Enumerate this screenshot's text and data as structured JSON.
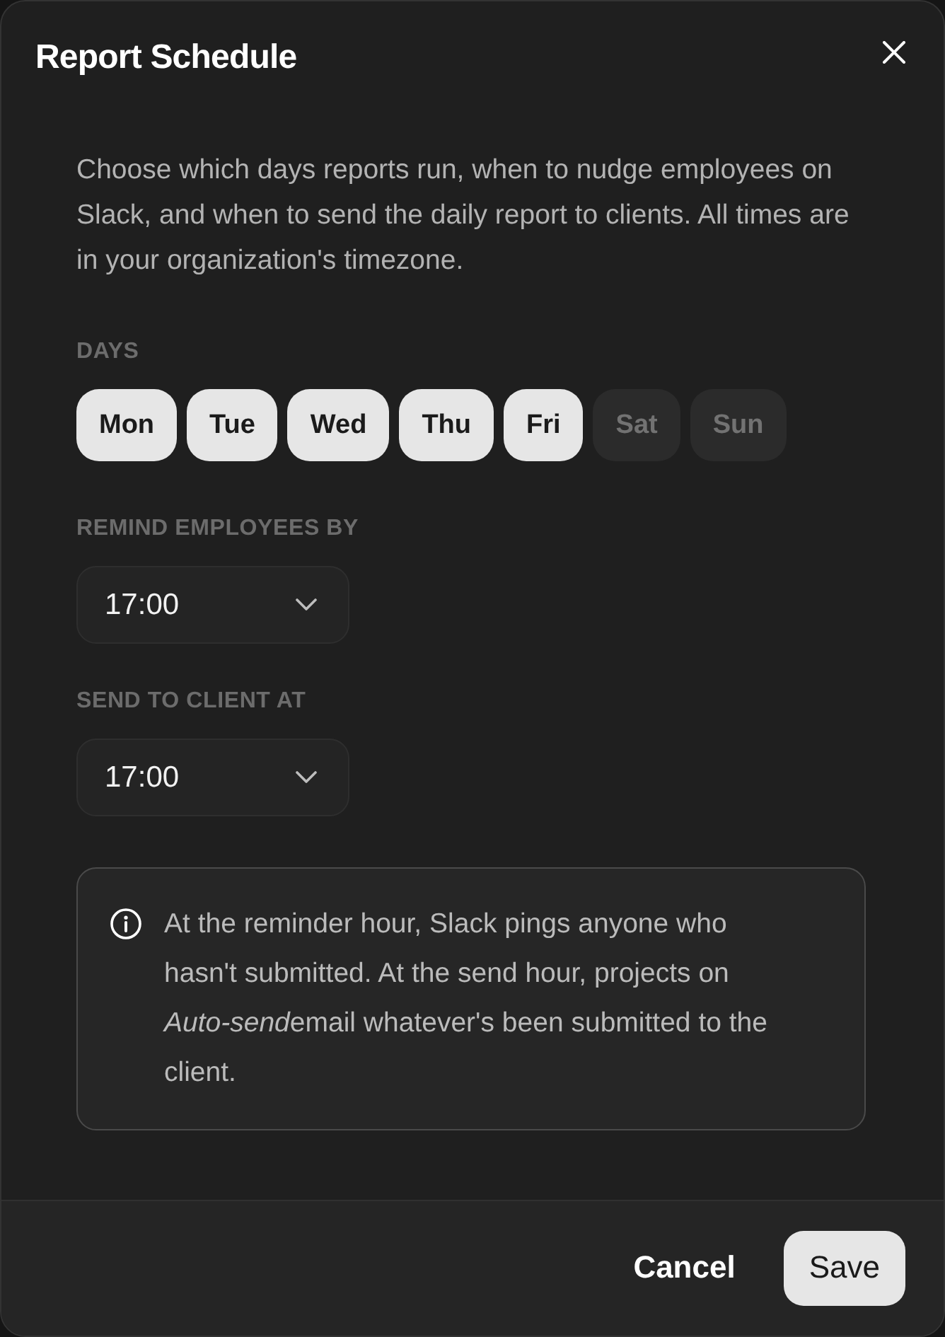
{
  "dialog": {
    "title": "Report Schedule",
    "description": "Choose which days reports run, when to nudge employees on Slack, and when to send the daily report to clients. All times are in your organization's timezone."
  },
  "days": {
    "label": "DAYS",
    "items": [
      {
        "label": "Mon",
        "selected": true
      },
      {
        "label": "Tue",
        "selected": true
      },
      {
        "label": "Wed",
        "selected": true
      },
      {
        "label": "Thu",
        "selected": true
      },
      {
        "label": "Fri",
        "selected": true
      },
      {
        "label": "Sat",
        "selected": false
      },
      {
        "label": "Sun",
        "selected": false
      }
    ]
  },
  "fields": [
    {
      "label": "REMIND EMPLOYEES BY",
      "value": "17:00"
    },
    {
      "label": "SEND TO CLIENT AT",
      "value": "17:00"
    }
  ],
  "info": {
    "runs": [
      {
        "text": "At the reminder hour, Slack pings anyone who hasn't submitted. At the send hour, projects on ",
        "italic": false
      },
      {
        "text": "Auto-send",
        "italic": true
      },
      {
        "text": "email whatever's been submitted to the client.",
        "italic": false
      }
    ]
  },
  "footer": {
    "buttons": [
      {
        "label": "Cancel",
        "kind": "secondary"
      },
      {
        "label": "Save",
        "kind": "primary"
      }
    ]
  }
}
